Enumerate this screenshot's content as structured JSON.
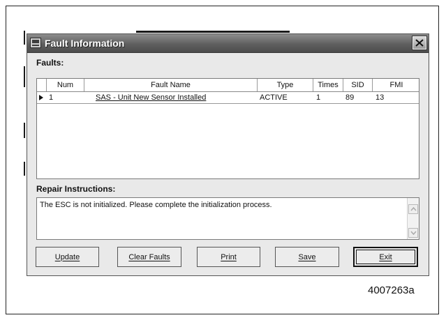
{
  "window": {
    "title": "Fault Information",
    "close_icon": "close-icon"
  },
  "faults": {
    "label": "Faults:",
    "columns": [
      "Num",
      "Fault Name",
      "Type",
      "Times",
      "SID",
      "FMI"
    ],
    "rows": [
      {
        "num": "1",
        "fault_name": "SAS - Unit New Sensor Installed",
        "type": "ACTIVE",
        "times": "1",
        "sid": "89",
        "fmi": "13"
      }
    ]
  },
  "repair": {
    "label": "Repair Instructions:",
    "text": "The ESC is not initialized.  Please complete the initialization process."
  },
  "buttons": {
    "update": "Update",
    "clear_faults": "Clear Faults",
    "print": "Print",
    "save": "Save",
    "exit": "Exit"
  },
  "caption": "4007263a"
}
